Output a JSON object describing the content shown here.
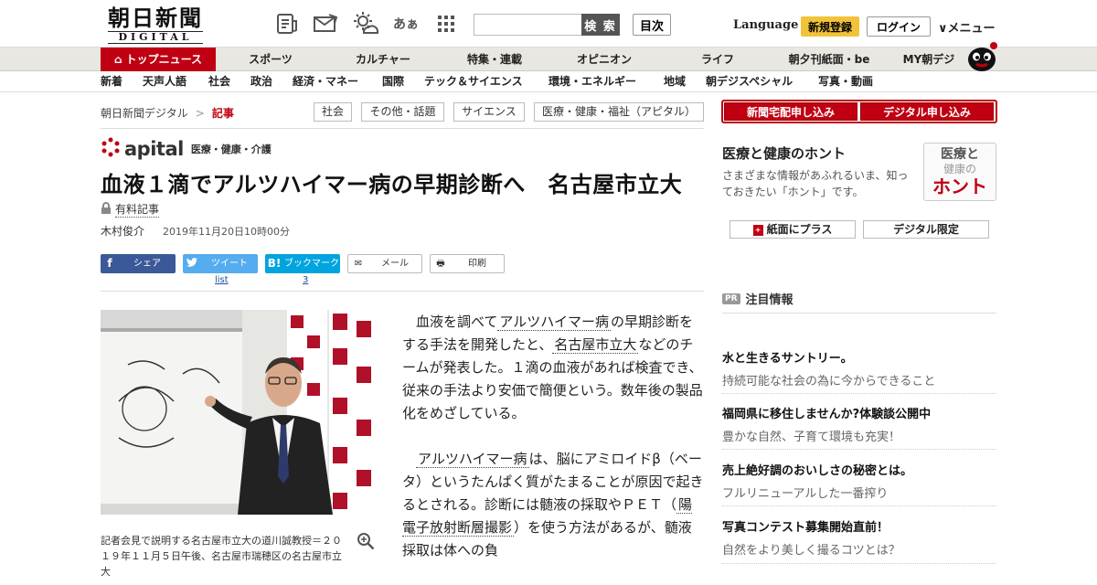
{
  "header": {
    "logo_main": "朝日新聞",
    "logo_sub": "DIGITAL",
    "search_button": "検 索",
    "search_placeholder": "",
    "toc_button": "目次",
    "language": "Language",
    "register": "新規登録",
    "login": "ログイン",
    "menu": "∨メニュー",
    "icons": [
      "newspaper-icon",
      "mail-icon",
      "weather-icon",
      "font-size-icon",
      "grid-icon"
    ],
    "font_icon_text": "あぁ"
  },
  "nav_primary": {
    "top_news": "トップニュース",
    "items": [
      "スポーツ",
      "カルチャー",
      "特集・連載",
      "オピニオン",
      "ライフ",
      "朝夕刊紙面・be",
      "MY朝デジ"
    ]
  },
  "nav_secondary": [
    "新着",
    "天声人語",
    "社会",
    "政治",
    "経済・マネー",
    "国際",
    "テック＆サイエンス",
    "環境・エネルギー",
    "地域",
    "朝デジスペシャル",
    "写真・動画"
  ],
  "breadcrumb": {
    "home": "朝日新聞デジタル",
    "sep": ">",
    "current": "記事"
  },
  "tags": [
    "社会",
    "その他・話題",
    "サイエンス",
    "医療・健康・福祉（アピタル）"
  ],
  "section": {
    "brand": "apital",
    "subtitle": "医療・健康・介護"
  },
  "article": {
    "title": "血液１滴でアルツハイマー病の早期診断へ　名古屋市立大",
    "paid_label": "有料記事",
    "author": "木村俊介",
    "date": "2019年11月20日10時00分",
    "caption": "記者会見で説明する名古屋市立大の道川誠教授＝２０１９年１１月５日午後、名古屋市瑞穂区の名古屋市立大",
    "p1_a": "血液を調べて",
    "p1_kw1": "アルツハイマー病",
    "p1_b": "の早期診断をする手法を開発したと、",
    "p1_kw2": "名古屋市立大",
    "p1_c": "などのチームが発表した。１滴の血液があれば検査でき、従来の手法より安価で簡便という。数年後の製品化をめざしている。",
    "p2_kw1": "アルツハイマー病",
    "p2_a": "は、脳にアミロイドβ（ベータ）というたんぱく質がたまることが原因で起きるとされる。診断には髄液の採取やＰＥＴ（",
    "p2_kw2": "陽電子放射断層撮影",
    "p2_b": "）を使う方法があるが、髄液採取は体への負"
  },
  "share": {
    "facebook": "シェア",
    "twitter": "ツイート",
    "hatena": "ブックマーク",
    "hatena_glyph": "B!",
    "mail": "メール",
    "print": "印刷",
    "twitter_count": "list",
    "hatena_count": "3",
    "colors": {
      "facebook": "#3b5998",
      "twitter": "#55acee",
      "hatena": "#00a4de"
    }
  },
  "sidebar": {
    "subscribe_paper": "新聞宅配申し込み",
    "subscribe_digital": "デジタル申し込み",
    "honto_title": "医療と健康のホント",
    "honto_desc": "さまざまな情報があふれるいま、知っておきたい「ホント」です。",
    "honto_logo_1": "医療と",
    "honto_logo_2": "健康の",
    "honto_logo_3": "ホント",
    "paper_plus": "紙面にプラス",
    "digital_only": "デジタル限定",
    "pr_badge": "PR",
    "pr_title": "注目情報",
    "ads": [
      {
        "title": "水と生きるサントリー。",
        "desc": "持続可能な社会の為に今からできること"
      },
      {
        "title": "福岡県に移住しませんか?体験談公開中",
        "desc": "豊かな自然、子育て環境も充実！"
      },
      {
        "title": "売上絶好調のおいしさの秘密とは。",
        "desc": "フルリニューアルした一番搾り"
      },
      {
        "title": "写真コンテスト募集開始直前！",
        "desc": "自然をより美しく撮るコツとは？"
      }
    ]
  },
  "colors": {
    "brand_red": "#c00012",
    "accent_yellow": "#f2c33a"
  }
}
